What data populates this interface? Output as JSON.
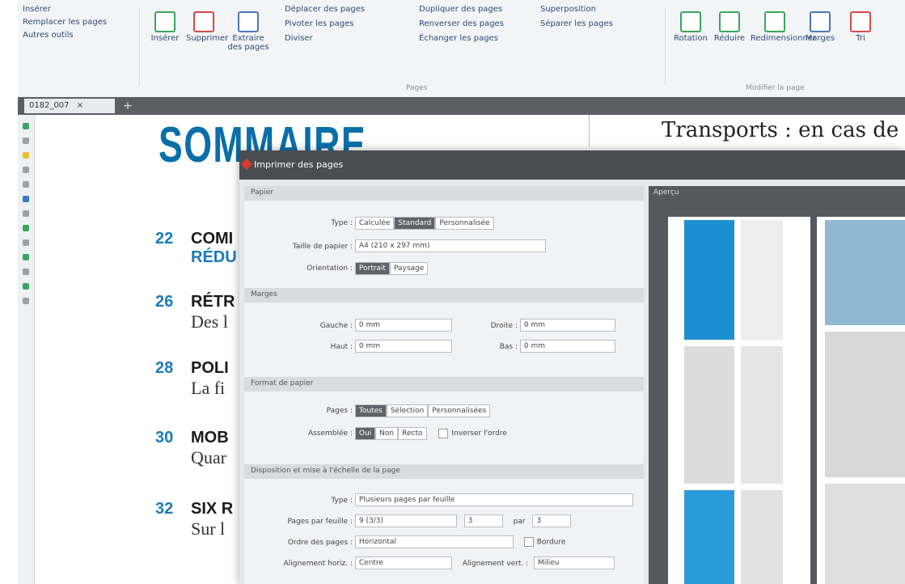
{
  "ribbon": {
    "small_items": [
      "Insérer",
      "Remplacer les pages",
      "Autres outils"
    ],
    "insert_label": "Insérer",
    "delete_label": "Supprimer",
    "extract_label": "Extraire des pages",
    "move_pages": "Déplacer des pages",
    "duplicate_pages": "Dupliquer des pages",
    "superpose": "Superposition",
    "rotate_pages": "Pivoter les pages",
    "reverse_pages": "Renverser des pages",
    "split_pages": "Séparer les pages",
    "split": "Diviser",
    "swap_pages": "Échanger les pages",
    "group_pages": "Pages",
    "group_modify": "Modifier la page",
    "right_btns": [
      "Rotation",
      "Réduire",
      "Redimensionner",
      "Marges",
      "Tri"
    ]
  },
  "tab": {
    "name": "0182_007",
    "close": "×",
    "plus": "+"
  },
  "document": {
    "masthead": "SOMMAIRE",
    "headline": "Transports : en cas de reta",
    "toc": [
      {
        "num": "22",
        "head": "COMI",
        "sub": "RÉDU"
      },
      {
        "num": "26",
        "head": "RÉTR",
        "sub": "Des l"
      },
      {
        "num": "28",
        "head": "POLI",
        "sub": "La fi"
      },
      {
        "num": "30",
        "head": "MOB",
        "sub": "Quar"
      },
      {
        "num": "32",
        "head": "SIX R",
        "sub": "Sur l"
      }
    ]
  },
  "dialog": {
    "title": "Imprimer des pages",
    "sec_paper": "Papier",
    "sec_margins": "Marges",
    "sec_format": "Format de papier",
    "sec_layout": "Disposition et mise à l'échelle de la page",
    "type_label": "Type :",
    "type_opts": [
      "Calculée",
      "Standard",
      "Personnalisée"
    ],
    "size_label": "Taille de papier :",
    "size_val": "A4 (210 x 297 mm)",
    "orient_label": "Orientation :",
    "orient_opts": [
      "Portrait",
      "Paysage"
    ],
    "left_label": "Gauche :",
    "left_val": "0 mm",
    "right_label": "Droite :",
    "right_val": "0 mm",
    "top_label": "Haut :",
    "top_val": "0 mm",
    "bottom_label": "Bas :",
    "bottom_val": "0 mm",
    "pages_label": "Pages :",
    "pages_opts": [
      "Toutes",
      "Sélection",
      "Personnalisées"
    ],
    "assemble_label": "Assemblée :",
    "assemble_opts": [
      "Oui",
      "Non",
      "Recto"
    ],
    "invert_label": "Inverser l'ordre",
    "layout_type_label": "Type :",
    "layout_type_val": "Plusieurs pages par feuille",
    "per_sheet_label": "Pages par feuille :",
    "per_sheet_val": "9 (3/3)",
    "cols_val": "3",
    "by_label": "par",
    "rows_val": "3",
    "order_label": "Ordre des pages :",
    "order_val": "Horizontal",
    "border_label": "Bordure",
    "halign_label": "Alignement horiz. :",
    "halign_val": "Centre",
    "valign_label": "Alignement vert. :",
    "valign_val": "Milieu",
    "preview_label": "Aperçu"
  }
}
